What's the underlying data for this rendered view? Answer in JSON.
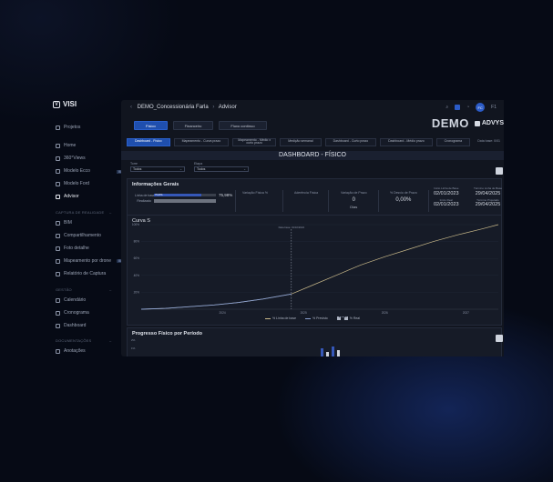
{
  "sidebar": {
    "logo": "VISI",
    "items_top": [
      {
        "label": "Projetos",
        "icon": "grid-icon"
      }
    ],
    "items_main": [
      {
        "label": "Home",
        "icon": "home-icon"
      },
      {
        "label": "360°Views",
        "icon": "cube-icon"
      },
      {
        "label": "Modelo Ecco",
        "icon": "layers-icon"
      },
      {
        "label": "Modelo Ford",
        "icon": "layers-icon"
      },
      {
        "label": "Advisor",
        "icon": "chart-icon",
        "active": true
      }
    ],
    "section_capture": "CAPTURA DE REALIDADE",
    "items_capture": [
      {
        "label": "BIM",
        "icon": "cube-icon"
      },
      {
        "label": "Compartilhamento",
        "icon": "share-icon"
      },
      {
        "label": "Foto detalhe",
        "icon": "image-icon"
      },
      {
        "label": "Mapeamento por drone",
        "icon": "drone-icon",
        "badge": "BETA"
      },
      {
        "label": "Relatório de Captura",
        "icon": "report-icon"
      }
    ],
    "section_gestao": "GESTÃO",
    "items_gestao": [
      {
        "label": "Calendário",
        "icon": "calendar-icon"
      },
      {
        "label": "Cronograma",
        "icon": "timeline-icon"
      },
      {
        "label": "Dashboard",
        "icon": "dashboard-icon"
      }
    ],
    "section_docs": "DOCUMENTAÇÕES",
    "items_docs": [
      {
        "label": "Anotações",
        "icon": "note-icon"
      }
    ],
    "beta_badge": "BETA"
  },
  "topbar": {
    "project": "DEMO_Concessionária Farla",
    "page": "Advisor",
    "avatar": "FC",
    "user_short": "F1"
  },
  "tabs_primary": [
    {
      "label": "Físico",
      "active": true
    },
    {
      "label": "Financeiro",
      "active": false
    },
    {
      "label": "Fluxo contínuo",
      "active": false
    }
  ],
  "brand": {
    "demo": "DEMO",
    "advisor": "ADVYS"
  },
  "tabs_secondary": [
    {
      "label": "Dashboard - Físico",
      "active": true
    },
    {
      "label": "Mapeamento - Curva prazo",
      "active": false
    },
    {
      "label": "Mapeamento - Médio x curto prazo",
      "active": false
    },
    {
      "label": "Medição semanal",
      "active": false
    },
    {
      "label": "Dashboard - Curto prazo",
      "active": false
    },
    {
      "label": "Dashboard - Médio prazo",
      "active": false
    },
    {
      "label": "Cronograma",
      "active": false
    }
  ],
  "date_info": "Data base: 0/01",
  "dashboard_title": "DASHBOARD - FÍSICO",
  "filters": [
    {
      "label": "Torre",
      "value": "Todos"
    },
    {
      "label": "Etapa",
      "value": "Todos"
    }
  ],
  "info": {
    "title": "Informações Gerais",
    "bars": [
      {
        "label": "Linha de base",
        "tag": "75,97%",
        "fraction": 0.76,
        "color": "blue"
      },
      {
        "label": "Realizado",
        "tag": "",
        "fraction": 1.0,
        "color": "gray"
      }
    ],
    "bar_value": "75,98%",
    "cols": [
      {
        "label": "Variação Física %",
        "value": "",
        "sub": ""
      },
      {
        "label": "Aderência Física",
        "value": "",
        "sub": ""
      },
      {
        "label": "Variação de Prazo",
        "value": "0",
        "sub": "Dias"
      },
      {
        "label": "% Desvio de Prazo",
        "value": "0,00%",
        "sub": ""
      }
    ],
    "dates_left": [
      {
        "label": "Início Linha de Base",
        "value": "02/01/2023"
      },
      {
        "label": "Início Real",
        "value": "02/01/2023"
      }
    ],
    "dates_right": [
      {
        "label": "Término Linha de Base",
        "value": "29/04/2025"
      },
      {
        "label": "Término Projetado",
        "value": "29/04/2025"
      }
    ]
  },
  "chart_data": {
    "type": "line",
    "title": "Curva S",
    "xlabel": "",
    "ylabel": "",
    "y_ticks": [
      "100%",
      "80%",
      "60%",
      "40%",
      "20%"
    ],
    "x_ticks": [
      "2024",
      "2025",
      "2026",
      "2027"
    ],
    "ylim": [
      0,
      100
    ],
    "xlim": [
      2023.0,
      2027.4
    ],
    "today_marker": {
      "x": 2024.85,
      "label": "Data base: 01/10/2024"
    },
    "series": [
      {
        "name": "% Linha de base",
        "color": "#c9b98a",
        "x": [
          2023.0,
          2023.3,
          2023.6,
          2023.9,
          2024.2,
          2024.5,
          2024.85,
          2025.1,
          2025.4,
          2025.7,
          2026.0,
          2026.3,
          2026.6,
          2026.9,
          2027.2,
          2027.4
        ],
        "values": [
          0,
          1,
          3,
          5,
          8,
          12,
          18,
          28,
          40,
          52,
          62,
          71,
          80,
          88,
          95,
          100
        ]
      },
      {
        "name": "% Previsto",
        "color": "#8aa0d0",
        "x": [
          2023.0,
          2023.3,
          2023.6,
          2023.9,
          2024.2,
          2024.5,
          2024.85
        ],
        "values": [
          0,
          1,
          3,
          5,
          8,
          12,
          18
        ]
      }
    ],
    "legend_extra": "% Real",
    "legend_position": "bottom"
  },
  "progress": {
    "title": "Progresso Físico por Período",
    "y_ticks": [
      "2%",
      "1%"
    ],
    "values": [
      1.6,
      1.2,
      1.8,
      1.4
    ]
  }
}
